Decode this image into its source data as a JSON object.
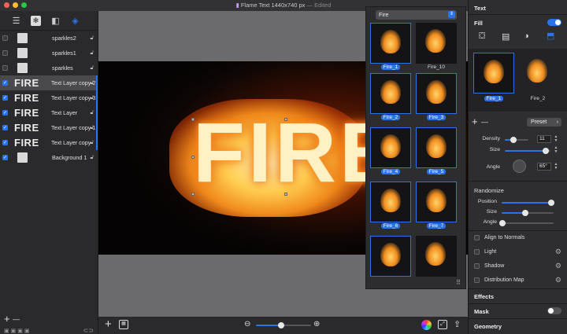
{
  "window": {
    "title": "Flame Text 1440x740 px",
    "edited": "— Edited",
    "traffic_lights": [
      "#fe5f57",
      "#febc2e",
      "#28c840"
    ]
  },
  "left_toolbar": {
    "icons": [
      "layers-list-icon",
      "settings-icon",
      "shapes-icon",
      "stack-icon"
    ]
  },
  "layers": [
    {
      "name": "sparkles2",
      "checked": false,
      "thumb": "plain",
      "locked": true
    },
    {
      "name": "sparkles1",
      "checked": false,
      "thumb": "plain",
      "locked": true
    },
    {
      "name": "sparkles",
      "checked": false,
      "thumb": "plain",
      "locked": true
    },
    {
      "name": "Text Layer copy 2",
      "checked": true,
      "thumb": "text",
      "thumb_text": "FIRE",
      "locked": true,
      "selected": true
    },
    {
      "name": "Text Layer copy 3",
      "checked": true,
      "thumb": "text",
      "thumb_text": "FIRE",
      "locked": true
    },
    {
      "name": "Text Layer",
      "checked": true,
      "thumb": "text",
      "thumb_text": "FIRE",
      "locked": true
    },
    {
      "name": "Text Layer copy 1",
      "checked": true,
      "thumb": "text",
      "thumb_text": "FIRE",
      "locked": true
    },
    {
      "name": "Text Layer copy",
      "checked": true,
      "thumb": "text",
      "thumb_text": "FIRE",
      "locked": true
    },
    {
      "name": "Background 1",
      "checked": true,
      "thumb": "plain",
      "locked": true
    }
  ],
  "left_bottom": {
    "add": "+",
    "remove": "—"
  },
  "canvas": {
    "text": "FIRE",
    "zoom_level": 0.45
  },
  "picker": {
    "selected_category": "Fire",
    "items": [
      {
        "label": "Fire_1",
        "selected": true
      },
      {
        "label": "Fire_10",
        "selected": false
      },
      {
        "label": "Fire_2",
        "selected": true
      },
      {
        "label": "Fire_3",
        "selected": true
      },
      {
        "label": "Fire_4",
        "selected": true
      },
      {
        "label": "Fire_5",
        "selected": true
      },
      {
        "label": "Fire_6",
        "selected": true
      },
      {
        "label": "Fire_7",
        "selected": true
      },
      {
        "label": "",
        "selected": true
      },
      {
        "label": "",
        "selected": false
      }
    ]
  },
  "inspector": {
    "text_header": "Text",
    "fill_label": "Fill",
    "fill_on": true,
    "fill_icons": [
      "paint-bucket-icon",
      "pattern-icon",
      "gradient-icon",
      "brush-icon"
    ],
    "brushes": [
      {
        "label": "Fire_1",
        "selected": true
      },
      {
        "label": "Fire_2",
        "selected": false
      }
    ],
    "preset_label": "Preset",
    "density": {
      "label": "Density",
      "value": "11",
      "level": 0.35
    },
    "size": {
      "label": "Size",
      "level": 0.9
    },
    "angle": {
      "label": "Angle",
      "value": "65°"
    },
    "randomize_header": "Randomize",
    "rand_position": {
      "label": "Position",
      "level": 0.95
    },
    "rand_size": {
      "label": "Size",
      "level": 0.45
    },
    "rand_angle": {
      "label": "Angle",
      "level": 0.02
    },
    "options": [
      {
        "label": "Align to Normals",
        "gear": false
      },
      {
        "label": "Light",
        "gear": true
      },
      {
        "label": "Shadow",
        "gear": true
      },
      {
        "label": "Distribution Map",
        "gear": true
      }
    ],
    "effects_header": "Effects",
    "mask_label": "Mask",
    "mask_on": false,
    "geometry_header": "Geometry",
    "accent": "#2a73e8"
  }
}
